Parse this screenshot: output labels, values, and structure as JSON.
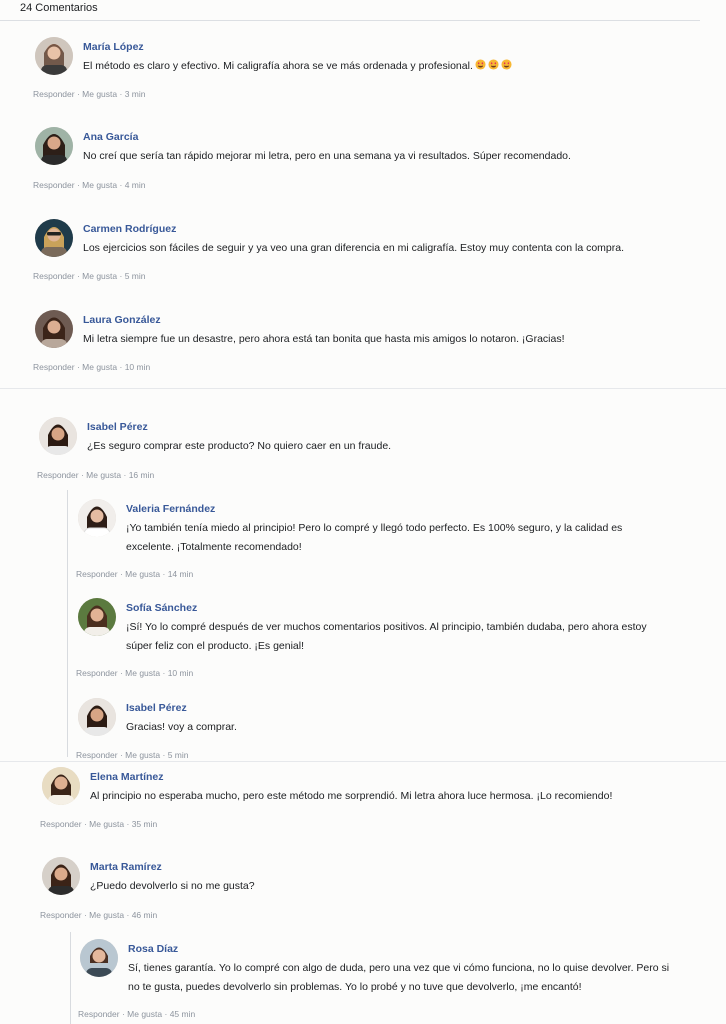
{
  "header": {
    "count_label": "24 Comentarios"
  },
  "actions": {
    "reply": "Responder",
    "like": "Me gusta",
    "sep": " · "
  },
  "comments": [
    {
      "name": "María López",
      "text": "El método es claro y efectivo. Mi caligrafía ahora se ve más ordenada y profesional.",
      "time": "3 min"
    },
    {
      "name": "Ana García",
      "text": "No creí que sería tan rápido mejorar mi letra, pero en una semana ya vi resultados. Súper recomendado.",
      "time": "4 min"
    },
    {
      "name": "Carmen Rodríguez",
      "text": "Los ejercicios son fáciles de seguir y ya veo una gran diferencia en mi caligrafía. Estoy muy contenta con la compra.",
      "time": "5 min"
    },
    {
      "name": "Laura González",
      "text": "Mi letra siempre fue un desastre, pero ahora está tan bonita que hasta mis amigos lo notaron. ¡Gracias!",
      "time": "10 min"
    },
    {
      "name": "Isabel Pérez",
      "text": "¿Es seguro comprar este producto? No quiero caer en un fraude.",
      "time": "16 min"
    },
    {
      "name": "Valeria Fernández",
      "text": "¡Yo también tenía miedo al principio! Pero lo compré y llegó todo perfecto. Es 100% seguro, y la calidad es excelente. ¡Totalmente recomendado!",
      "time": "14 min"
    },
    {
      "name": "Sofía Sánchez",
      "text": "¡Sí! Yo lo compré después de ver muchos comentarios positivos. Al principio, también dudaba, pero ahora estoy súper feliz con el producto. ¡Es genial!",
      "time": "10 min"
    },
    {
      "name": "Isabel Pérez",
      "text": "Gracias! voy a comprar.",
      "time": "5 min"
    },
    {
      "name": "Elena Martínez",
      "text": "Al principio no esperaba mucho, pero este método me sorprendió. Mi letra ahora luce hermosa. ¡Lo recomiendo!",
      "time": "35 min"
    },
    {
      "name": "Marta Ramírez",
      "text": "¿Puedo devolverlo si no me gusta?",
      "time": "46 min"
    },
    {
      "name": "Rosa Díaz",
      "text": "Sí, tienes garantía. Yo lo compré con algo de duda, pero una vez que vi cómo funciona, no lo quise devolver. Pero si no te gusta, puedes devolverlo sin problemas. Yo lo probé y no tuve que devolverlo, ¡me encantó!",
      "time": "45 min"
    }
  ],
  "colors": {
    "name": "#385898",
    "meta": "#8d949e",
    "text": "#1c1e21"
  }
}
